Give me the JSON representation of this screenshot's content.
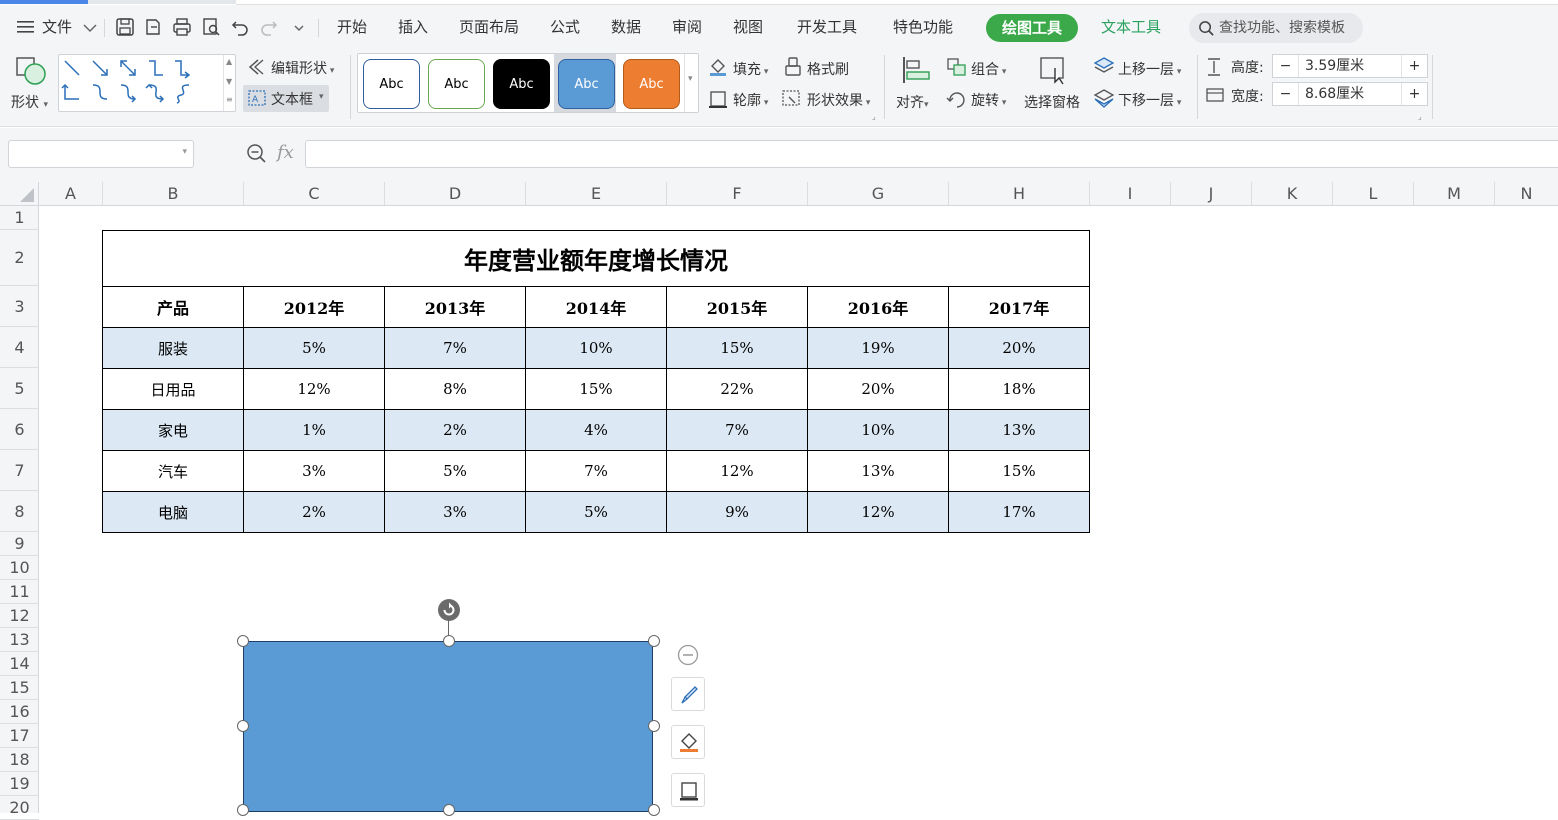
{
  "menubar": {
    "file": "文件",
    "tabs": [
      "开始",
      "插入",
      "页面布局",
      "公式",
      "数据",
      "审阅",
      "视图",
      "开发工具",
      "特色功能"
    ],
    "active_tab": "绘图工具",
    "text_tab": "文本工具",
    "search_placeholder": "查找功能、搜索模板"
  },
  "ribbon": {
    "shapes_label": "形状",
    "edit_shape": "编辑形状",
    "text_box": "文本框",
    "style_samples": [
      "Abc",
      "Abc",
      "Abc",
      "Abc",
      "Abc"
    ],
    "fill": "填充",
    "format_brush": "格式刷",
    "outline": "轮廓",
    "shape_effect": "形状效果",
    "align": "对齐",
    "group": "组合",
    "rotate": "旋转",
    "select_pane": "选择窗格",
    "bring_forward": "上移一层",
    "send_backward": "下移一层",
    "height_label": "高度:",
    "height_value": "3.59厘米",
    "width_label": "宽度:",
    "width_value": "8.68厘米"
  },
  "formula_bar": {
    "fx": "fx"
  },
  "sheet": {
    "columns": [
      "A",
      "B",
      "C",
      "D",
      "E",
      "F",
      "G",
      "H",
      "I",
      "J",
      "K",
      "L",
      "M",
      "N"
    ],
    "rows": [
      "1",
      "2",
      "3",
      "4",
      "5",
      "6",
      "7",
      "8",
      "9",
      "10",
      "11",
      "12",
      "13",
      "14",
      "15",
      "16",
      "17",
      "18",
      "19",
      "20"
    ]
  },
  "table": {
    "title": "年度营业额年度增长情况",
    "headers": [
      "产品",
      "2012年",
      "2013年",
      "2014年",
      "2015年",
      "2016年",
      "2017年"
    ],
    "rows": [
      [
        "服装",
        "5%",
        "7%",
        "10%",
        "15%",
        "19%",
        "20%"
      ],
      [
        "日用品",
        "12%",
        "8%",
        "15%",
        "22%",
        "20%",
        "18%"
      ],
      [
        "家电",
        "1%",
        "2%",
        "4%",
        "7%",
        "10%",
        "13%"
      ],
      [
        "汽车",
        "3%",
        "5%",
        "7%",
        "12%",
        "13%",
        "15%"
      ],
      [
        "电脑",
        "2%",
        "3%",
        "5%",
        "9%",
        "12%",
        "17%"
      ]
    ]
  },
  "colors": {
    "accent_green": "#3ba94a",
    "shape_fill": "#5b9bd5",
    "row_shade": "#dce9f5"
  }
}
